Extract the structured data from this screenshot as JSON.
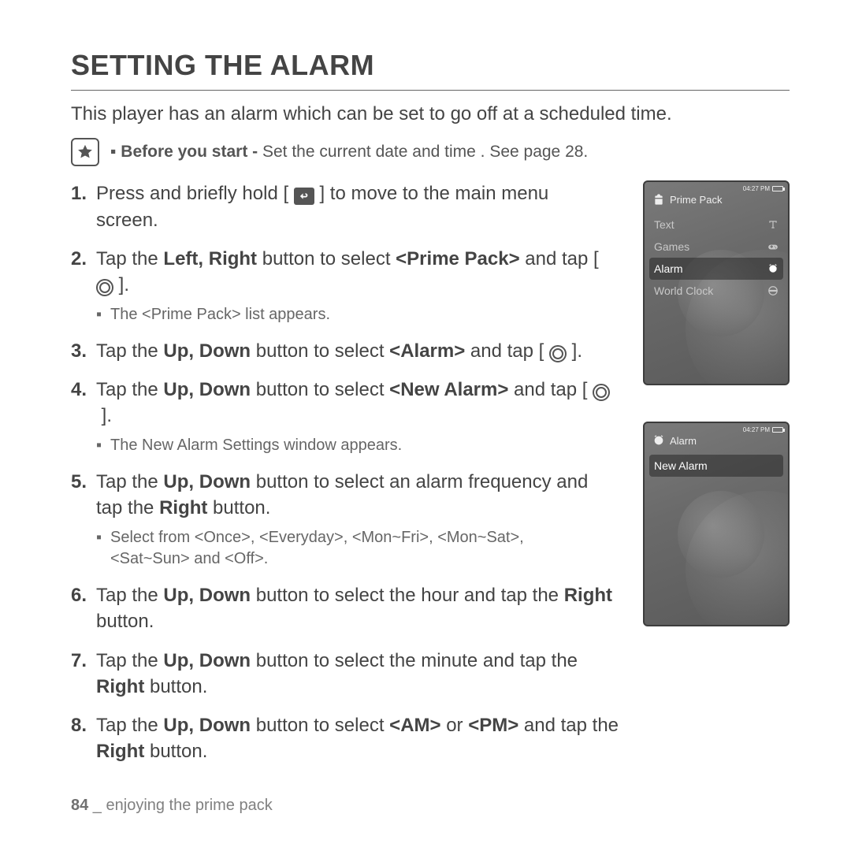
{
  "title": "SETTING THE ALARM",
  "intro": "This player has an alarm which can be set to go off at a scheduled time.",
  "before": {
    "lead": "Before you start -",
    "rest": " Set the current date and time . See page 28."
  },
  "steps": {
    "s1a": "Press and briefly hold [ ",
    "s1b": " ] to move to the main menu screen.",
    "s2a": "Tap the ",
    "s2b": "Left, Right",
    "s2c": " button to select ",
    "s2d": "<Prime Pack>",
    "s2e": " and tap [ ",
    "s2f": " ].",
    "s2sub": "The <Prime Pack> list appears.",
    "s3a": "Tap the ",
    "s3b": "Up, Down",
    "s3c": " button to select ",
    "s3d": "<Alarm>",
    "s3e": " and tap [ ",
    "s3f": " ].",
    "s4a": "Tap the ",
    "s4b": "Up, Down",
    "s4c": " button to select ",
    "s4d": "<New Alarm>",
    "s4e": " and tap [ ",
    "s4f": " ].",
    "s4sub": "The New Alarm Settings window appears.",
    "s5a": "Tap the ",
    "s5b": "Up, Down",
    "s5c": " button to select an alarm frequency and tap the ",
    "s5d": "Right",
    "s5e": " button.",
    "s5sub": "Select from <Once>, <Everyday>, <Mon~Fri>, <Mon~Sat>, <Sat~Sun> and <Off>.",
    "s6a": "Tap the ",
    "s6b": "Up, Down",
    "s6c": " button to select the hour and tap the ",
    "s6d": "Right",
    "s6e": " button.",
    "s7a": "Tap the ",
    "s7b": "Up, Down",
    "s7c": " button to select the minute and tap the ",
    "s7d": "Right",
    "s7e": " button.",
    "s8a": "Tap the ",
    "s8b": "Up, Down",
    "s8c": " button to select ",
    "s8d": "<AM>",
    "s8e": " or ",
    "s8f": "<PM>",
    "s8g": " and tap the ",
    "s8h": "Right",
    "s8i": " button."
  },
  "device1": {
    "time": "04:27 PM",
    "title": "Prime Pack",
    "items": {
      "text": "Text",
      "games": "Games",
      "alarm": "Alarm",
      "world": "World Clock"
    }
  },
  "device2": {
    "time": "04:27 PM",
    "title": "Alarm",
    "item": "New Alarm"
  },
  "footer": {
    "page": "84",
    "sep": " _ ",
    "section": "enjoying the prime pack"
  }
}
